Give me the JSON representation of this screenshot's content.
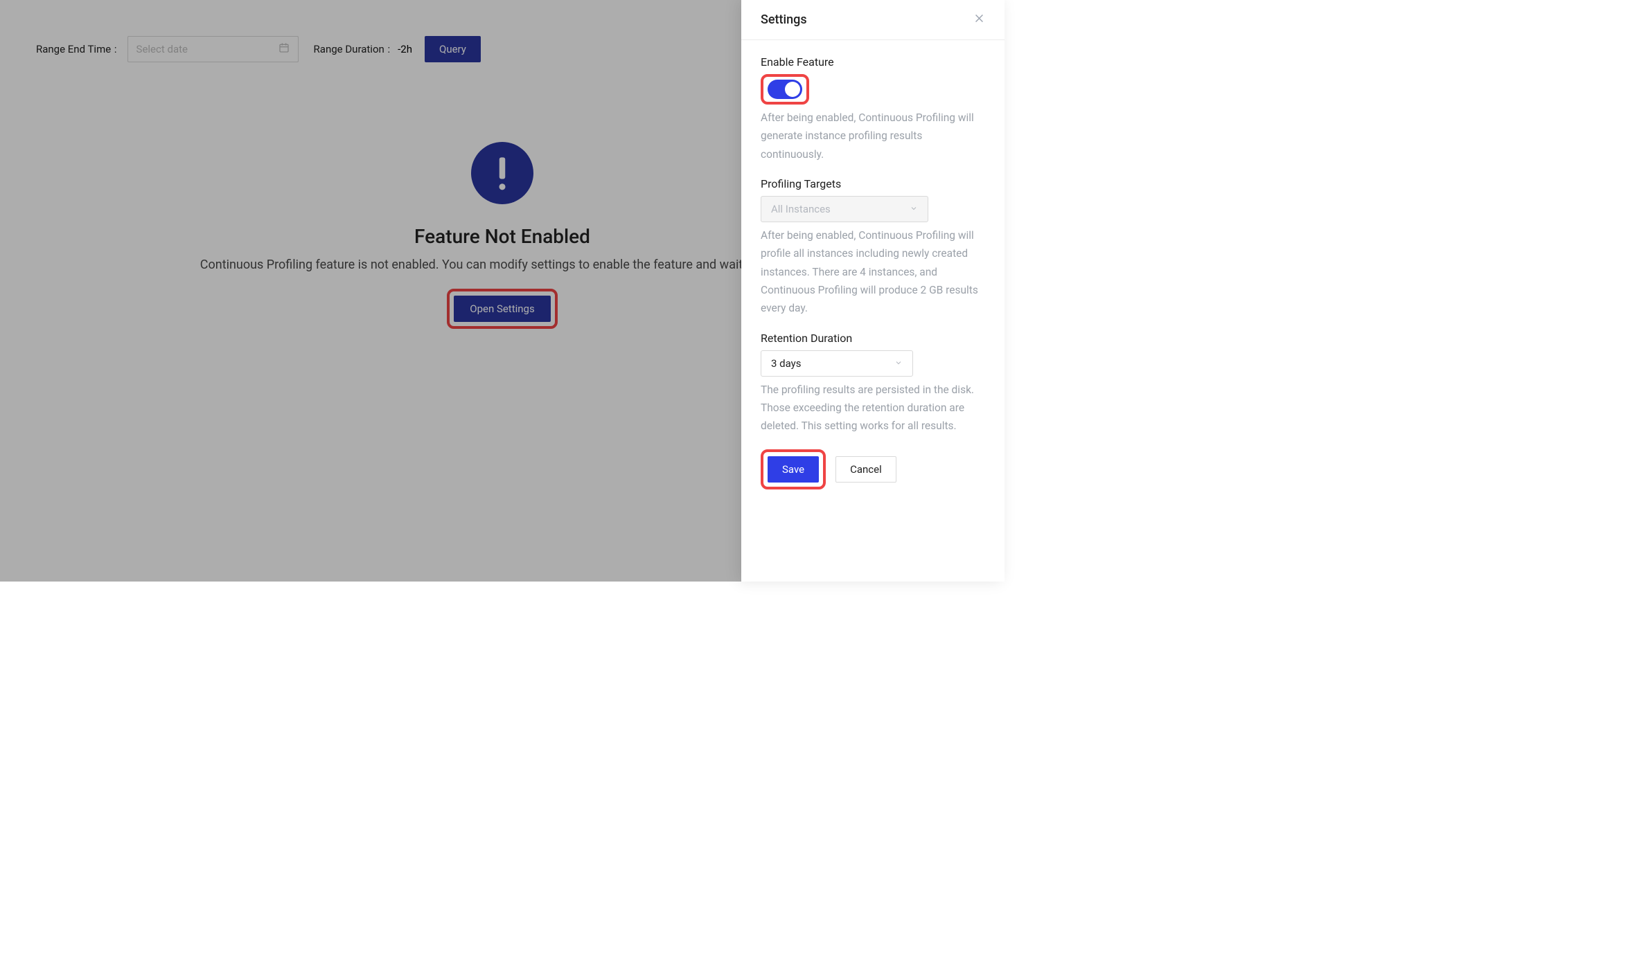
{
  "toolbar": {
    "range_end_time_label": "Range End Time",
    "date_placeholder": "Select date",
    "range_duration_label": "Range Duration",
    "range_duration_value": "-2h",
    "query_label": "Query"
  },
  "empty": {
    "title": "Feature Not Enabled",
    "description": "Continuous Profiling feature is not enabled. You can modify settings to enable the feature and wait for new da",
    "button_label": "Open Settings"
  },
  "drawer": {
    "title": "Settings",
    "enable_feature": {
      "label": "Enable Feature",
      "enabled": true,
      "help": "After being enabled, Continuous Profiling will generate instance profiling results continuously."
    },
    "profiling_targets": {
      "label": "Profiling Targets",
      "value": "All Instances",
      "help": "After being enabled, Continuous Profiling will profile all instances including newly created instances. There are 4 instances, and Continuous Profiling will produce 2 GB results every day."
    },
    "retention": {
      "label": "Retention Duration",
      "value": "3 days",
      "help": "The profiling results are persisted in the disk. Those exceeding the retention duration are deleted. This setting works for all results."
    },
    "save_label": "Save",
    "cancel_label": "Cancel"
  },
  "colors": {
    "primary_dark": "#2a36a0",
    "primary": "#2f3ee6",
    "highlight": "#ef4444"
  }
}
